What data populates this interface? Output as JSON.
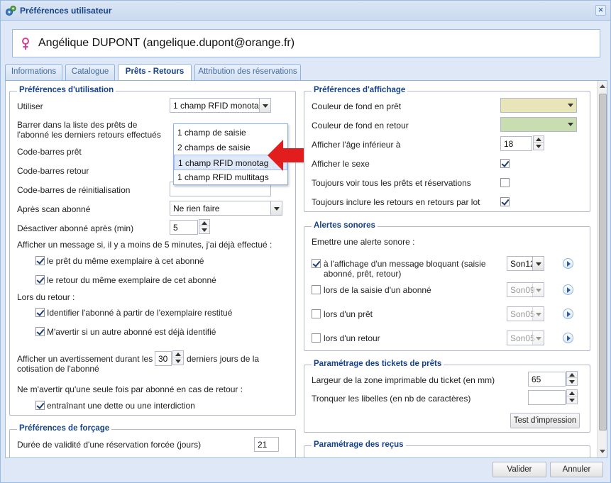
{
  "window": {
    "title": "Préférences utilisateur",
    "close_label": "×"
  },
  "user": {
    "display": "Angélique DUPONT (angelique.dupont@orange.fr)"
  },
  "tabs": [
    "Informations",
    "Catalogue",
    "Prêts - Retours",
    "Attribution des réservations"
  ],
  "left": {
    "utilisation": {
      "legend": "Préférences d'utilisation",
      "utiliser_label": "Utiliser",
      "utiliser_value": "1 champ RFID monotag",
      "barrer_label": "Barrer dans la liste des prêts de l'abonné les derniers retours effectués",
      "codebarres_pret_label": "Code-barres prêt",
      "codebarres_retour_label": "Code-barres retour",
      "codebarres_reinit_label": "Code-barres de réinitialisation",
      "apres_scan_label": "Après scan abonné",
      "apres_scan_value": "Ne rien faire",
      "desactiver_label": "Désactiver abonné après (min)",
      "desactiver_value": "5",
      "message_label": "Afficher un message si, il y a moins de 5 minutes, j'ai déjà effectué :",
      "pret_meme_label": "le prêt du même exemplaire à cet abonné",
      "retour_meme_label": "le retour du même exemplaire de cet abonné",
      "lors_retour_label": "Lors du retour :",
      "identifier_label": "Identifier l'abonné à partir de l'exemplaire restitué",
      "avertir_label": "M'avertir si un autre abonné est déjà identifié",
      "avertissement_before": "Afficher un avertissement durant les",
      "avertissement_value": "30",
      "avertissement_after": "derniers jours de la cotisation de l'abonné",
      "une_fois_label": "Ne m'avertir qu'une seule fois par abonné en cas de retour :",
      "dette_label": "entraînant une dette ou une interdiction"
    },
    "dropdown_options": [
      "1 champ de saisie",
      "2 champs de saisie",
      "1 champ RFID monotag",
      "1 champ RFID multitags"
    ],
    "forcage": {
      "legend": "Préférences de forçage",
      "duree_label": "Durée de validité d'une réservation forcée (jours)",
      "duree_value": "21"
    }
  },
  "right": {
    "affichage": {
      "legend": "Préférences d'affichage",
      "fond_pret_label": "Couleur de fond en prêt",
      "fond_retour_label": "Couleur de fond en retour",
      "age_label": "Afficher l'âge inférieur à",
      "age_value": "18",
      "sexe_label": "Afficher le sexe",
      "toujours_voir_label": "Toujours voir tous les prêts et réservations",
      "toujours_inclure_label": "Toujours inclure les retours en retours par lot",
      "fond_pret_color": "#e8e6b8",
      "fond_retour_color": "#c9deb0"
    },
    "alertes": {
      "legend": "Alertes sonores",
      "emettre_label": "Emettre une alerte sonore :",
      "bloquant_label": "à l'affichage d'un message bloquant (saisie abonné, prêt, retour)",
      "bloquant_son": "Son12",
      "saisie_label": "lors de la saisie d'un abonné",
      "saisie_son": "Son09",
      "pret_label": "lors d'un prêt",
      "pret_son": "Son05",
      "retour_label": "lors d'un retour",
      "retour_son": "Son05"
    },
    "tickets": {
      "legend": "Paramétrage des tickets de prêts",
      "largeur_label": "Largeur de la zone imprimable du ticket (en mm)",
      "largeur_value": "65",
      "tronquer_label": "Tronquer les libelles (en nb de caractères)",
      "test_button": "Test d'impression"
    },
    "recus": {
      "legend": "Paramétrage des reçus"
    }
  },
  "footer": {
    "valider": "Valider",
    "annuler": "Annuler"
  }
}
